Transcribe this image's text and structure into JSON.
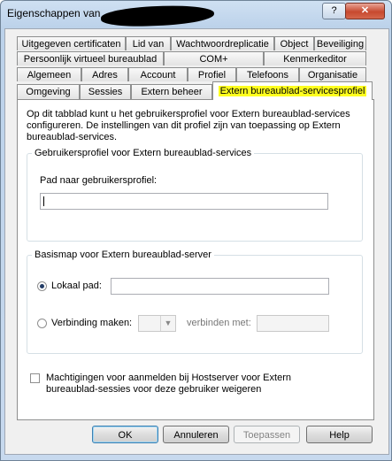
{
  "window": {
    "title": "Eigenschappen van",
    "help_glyph": "?",
    "close_glyph": "✕"
  },
  "tabs": {
    "row1": [
      "Uitgegeven certificaten",
      "Lid van",
      "Wachtwoordreplicatie",
      "Object",
      "Beveiliging"
    ],
    "row2": [
      "Persoonlijk virtueel bureaublad",
      "COM+",
      "Kenmerkeditor"
    ],
    "row3": [
      "Algemeen",
      "Adres",
      "Account",
      "Profiel",
      "Telefoons",
      "Organisatie"
    ],
    "row4": [
      "Omgeving",
      "Sessies",
      "Extern beheer",
      "Extern bureaublad-servicesprofiel"
    ],
    "active": "Extern bureaublad-servicesprofiel"
  },
  "panel": {
    "intro": "Op dit tabblad kunt u het gebruikersprofiel voor Extern bureaublad-services configureren. De instellingen van dit profiel zijn van toepassing op Extern bureaublad-services.",
    "profile_group": {
      "legend": "Gebruikersprofiel voor Extern bureaublad-services",
      "path_label": "Pad naar gebruikersprofiel:",
      "path_value": ""
    },
    "home_group": {
      "legend": "Basismap voor Extern bureaublad-server",
      "local_label": "Lokaal pad:",
      "local_value": "",
      "local_selected": true,
      "connect_label": "Verbinding maken:",
      "connect_to_label": "verbinden met:",
      "drive_value": "",
      "connect_to_value": ""
    },
    "deny_checkbox": {
      "label_line1": "Machtigingen voor aanmelden bij Hostserver voor Extern",
      "label_line2": "bureaublad-sessies voor deze gebruiker weigeren",
      "checked": false
    }
  },
  "buttons": {
    "ok": "OK",
    "cancel": "Annuleren",
    "apply": "Toepassen",
    "help": "Help"
  },
  "colors": {
    "highlight": "#ffff1f",
    "title_bar": "#c7d9ee",
    "close": "#c7492f"
  }
}
